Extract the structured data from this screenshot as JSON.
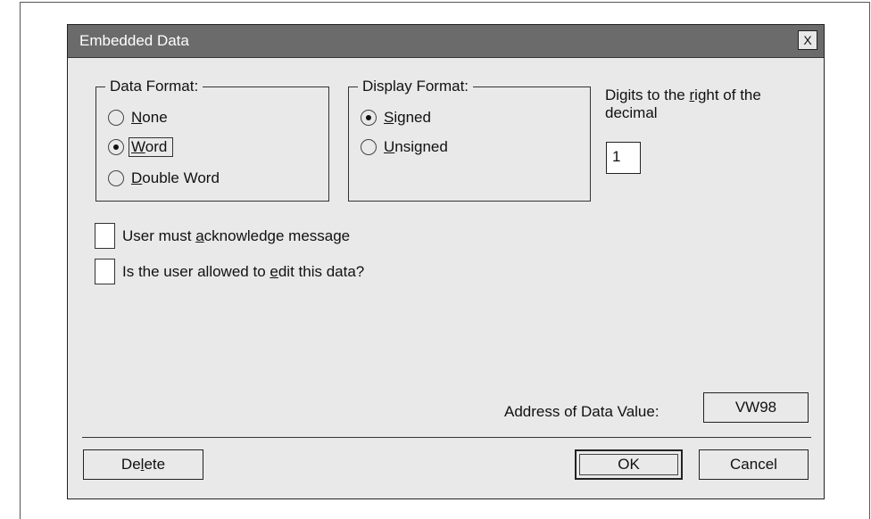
{
  "dialog": {
    "title": "Embedded Data",
    "close_glyph": "X"
  },
  "data_format": {
    "title": "Data Format:",
    "options": [
      {
        "pre": "",
        "key": "N",
        "post": "one",
        "checked": false
      },
      {
        "pre": "",
        "key": "W",
        "post": "ord",
        "checked": true
      },
      {
        "pre": "",
        "key": "D",
        "post": "ouble Word",
        "checked": false
      }
    ]
  },
  "display_format": {
    "title": "Display Format:",
    "options": [
      {
        "pre": "",
        "key": "S",
        "post": "igned",
        "checked": true
      },
      {
        "pre": "",
        "key": "U",
        "post": "nsigned",
        "checked": false
      }
    ]
  },
  "digits": {
    "label_line1_pre": "Digits to the ",
    "label_line1_key": "r",
    "label_line1_post": "ight of the",
    "label_line2": "decimal",
    "value": "1"
  },
  "checkboxes": [
    {
      "pre": "User must ",
      "key": "a",
      "post": "cknowledge message",
      "checked": false
    },
    {
      "pre": "Is the user allowed to ",
      "key": "e",
      "post": "dit this data?",
      "checked": false
    }
  ],
  "address": {
    "label": "Address of Data Value:",
    "value": "VW98"
  },
  "buttons": {
    "delete_pre": "De",
    "delete_key": "l",
    "delete_post": "ete",
    "ok": "OK",
    "cancel": "Cancel"
  }
}
